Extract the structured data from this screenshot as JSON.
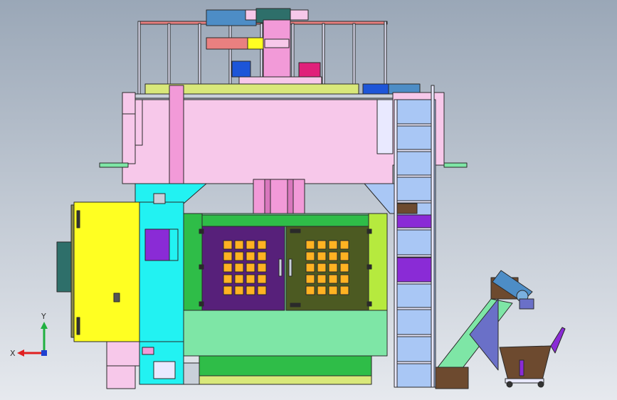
{
  "viewport": {
    "background_top": "#9aa7b7",
    "background_bottom": "#e6e9ee"
  },
  "axes": {
    "x_label": "X",
    "y_label": "Y",
    "x_color": "#e02020",
    "y_color": "#20b040",
    "z_color": "#2040d0"
  },
  "colors": {
    "outline": "#2a2a2a",
    "pink_light": "#f7c8ea",
    "pink": "#f29ad8",
    "yellow": "#ffff22",
    "cyan": "#22f2f2",
    "blue_light": "#a9c7f5",
    "purple": "#57207a",
    "olive": "#4c5a22",
    "orange_tile": "#ffb222",
    "green_light": "#7ee6a6",
    "lime": "#b6ea3e",
    "green": "#2fbd48",
    "khaki": "#d9e87a",
    "brown": "#6d4a2f",
    "teal": "#2e6f6a",
    "blue": "#1d55d8",
    "magenta": "#e0207a",
    "violet": "#8a2bd6",
    "salmon": "#e98080",
    "steel_blue": "#4d8dc6"
  }
}
